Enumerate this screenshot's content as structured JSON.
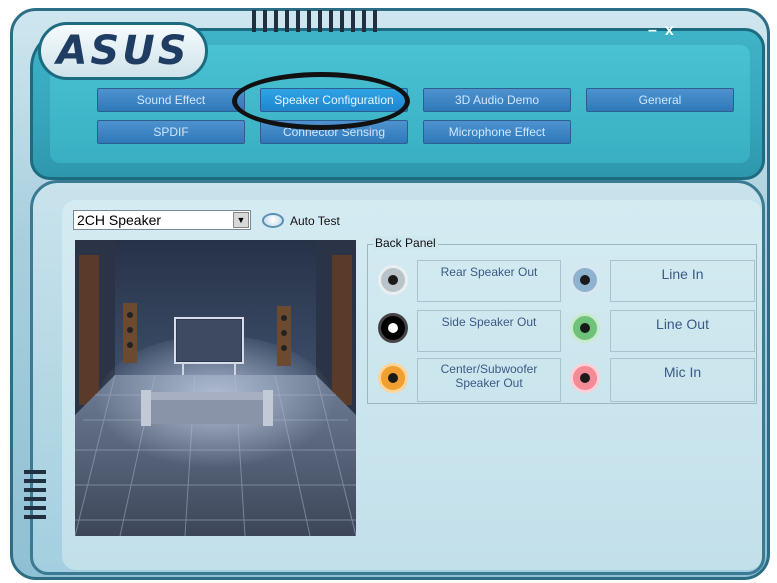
{
  "brand": {
    "logo_text": "ASUS"
  },
  "window_controls": {
    "minimize": "–",
    "close": "x"
  },
  "nav": {
    "row1": [
      "Sound Effect",
      "Speaker Configuration",
      "3D Audio Demo",
      "General"
    ],
    "row2": [
      "SPDIF",
      "Connector Sensing",
      "Microphone Effect"
    ],
    "active": "Speaker Configuration"
  },
  "speaker_select": {
    "value": "2CH Speaker",
    "arrow": "▼"
  },
  "auto_test": {
    "label": "Auto Test"
  },
  "back_panel": {
    "title": "Back Panel",
    "jacks": [
      {
        "label": "Rear Speaker Out",
        "color": "#b9c3c9"
      },
      {
        "label": "Line In",
        "color": "#8db3cf"
      },
      {
        "label": "Side Speaker Out",
        "color": "#000000"
      },
      {
        "label": "Line Out",
        "color": "#6fc27a"
      },
      {
        "label": "Center/Subwoofer Speaker Out",
        "color": "#f0a030"
      },
      {
        "label": "Mic In",
        "color": "#f28b96"
      }
    ]
  }
}
